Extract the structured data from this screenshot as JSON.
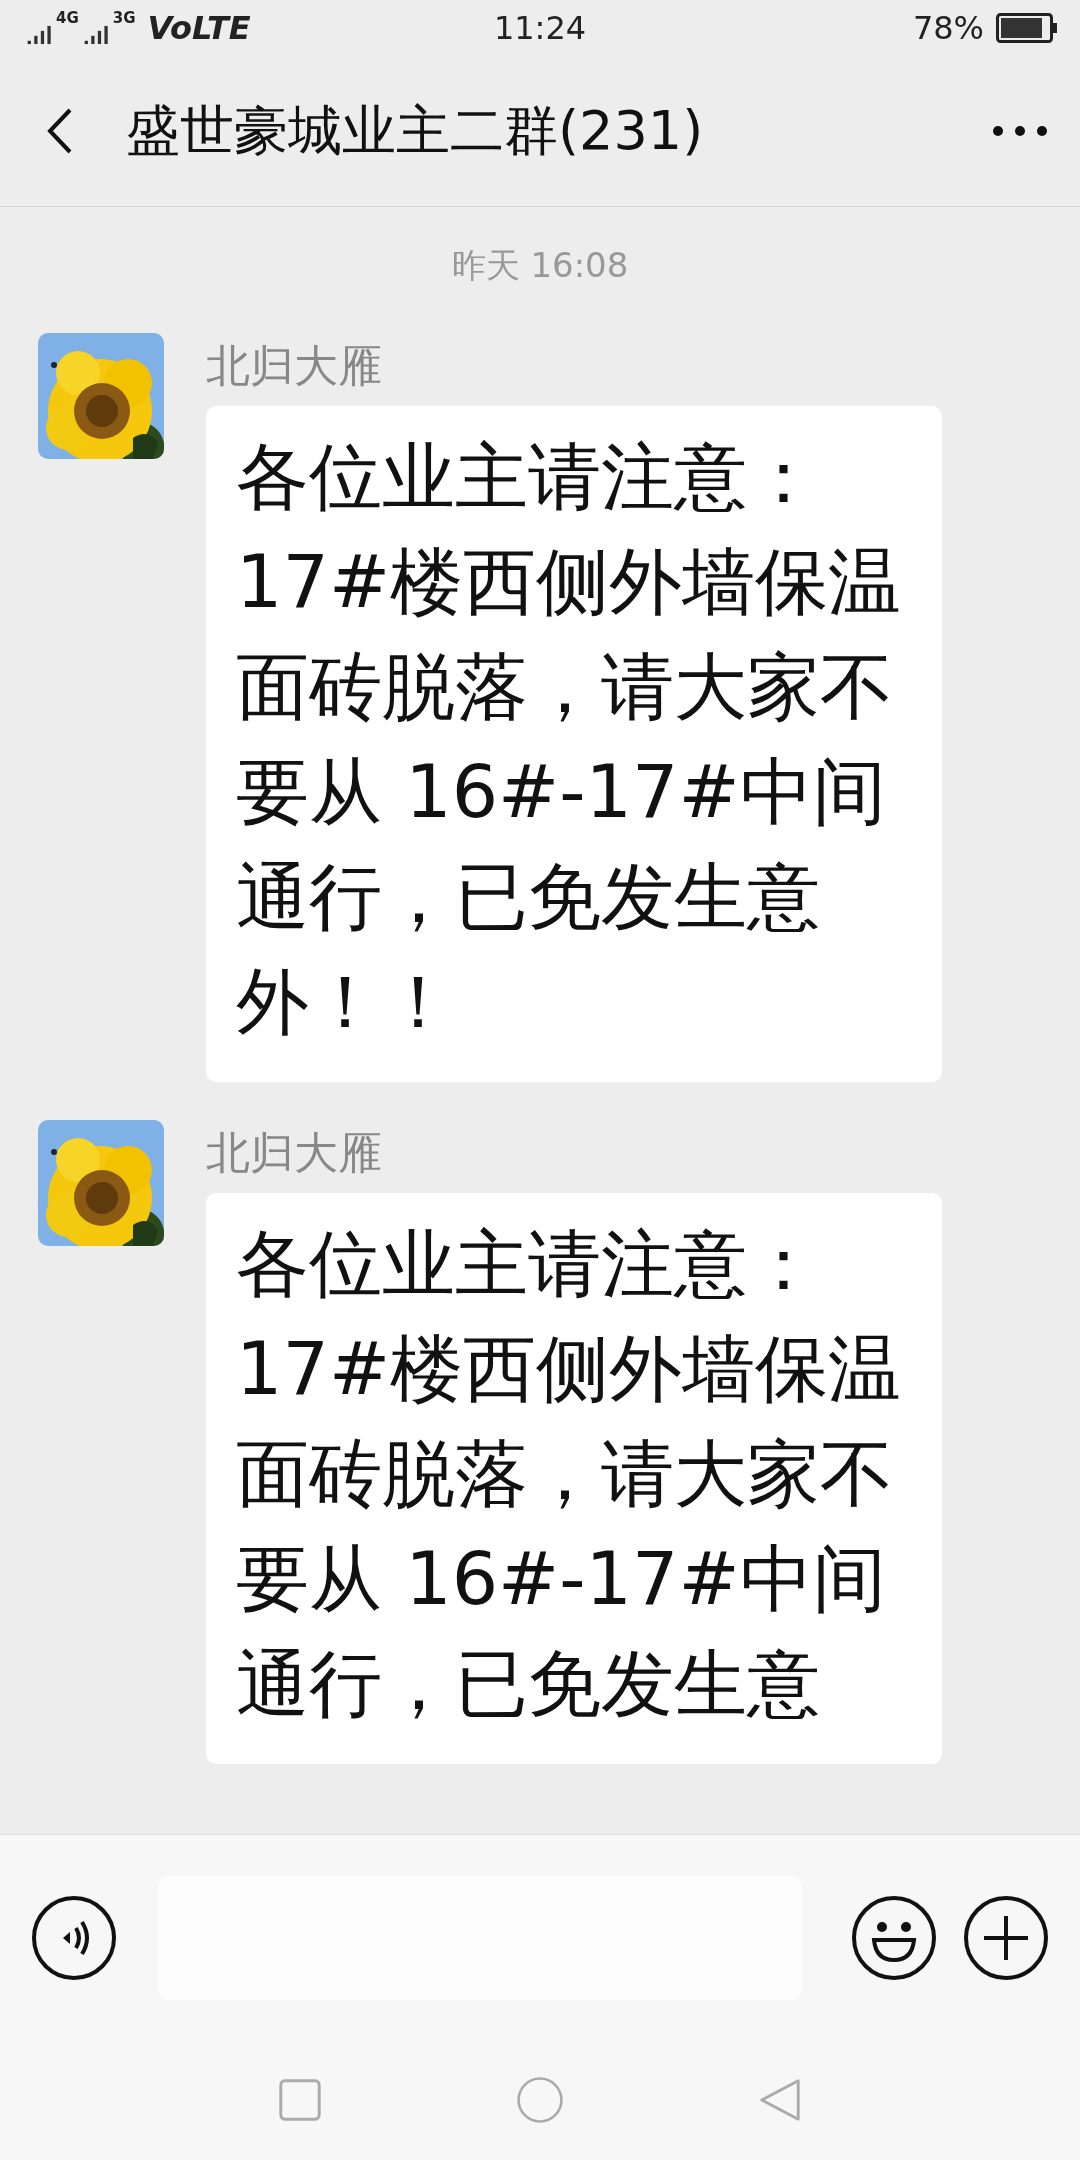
{
  "status_bar": {
    "network_1": "4G",
    "network_2": "3G",
    "volte": "VoLTE",
    "time": "11:24",
    "battery": "78%"
  },
  "header": {
    "title": "盛世豪城业主二群(231)"
  },
  "messages": [
    {
      "kind": "time",
      "text": "昨天 16:08"
    },
    {
      "kind": "text",
      "sender": "北归大雁",
      "text": "各位业主请注意：17#楼西侧外墙保温面砖脱落，请大家不要从 16#-17#中间通行，已免发生意外！！"
    },
    {
      "kind": "text",
      "sender": "北归大雁",
      "text": "各位业主请注意：17#楼西侧外墙保温面砖脱落，请大家不要从 16#-17#中间通行，已免发生意"
    }
  ]
}
